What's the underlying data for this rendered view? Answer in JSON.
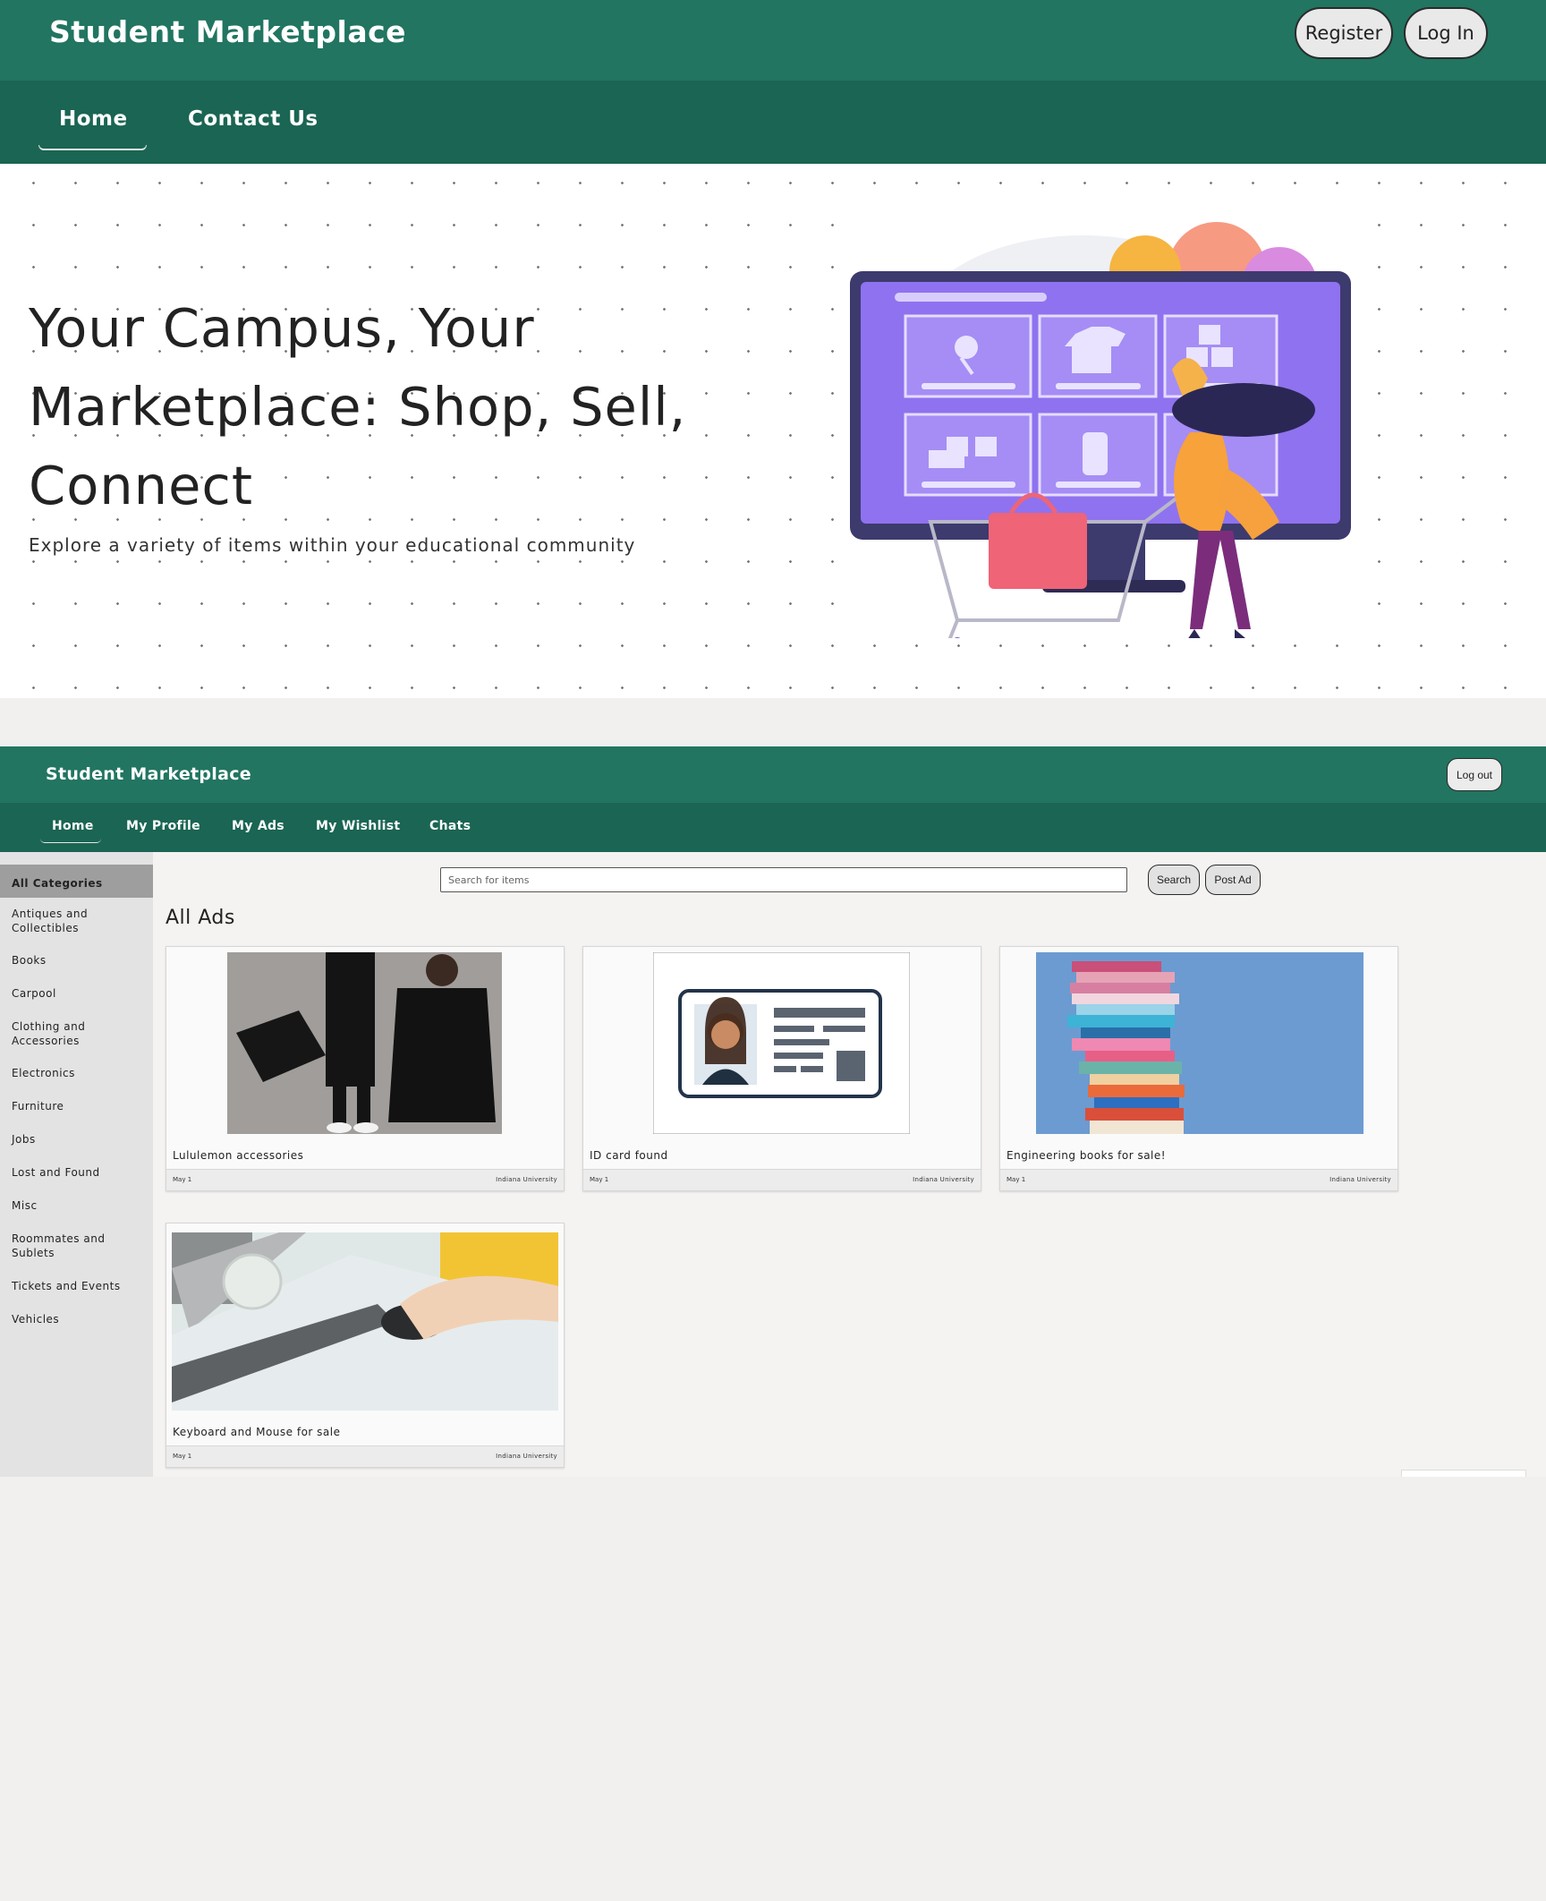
{
  "landing": {
    "brand": "Student Marketplace",
    "register_label": "Register",
    "login_label": "Log In",
    "nav": {
      "home": "Home",
      "contact": "Contact Us"
    },
    "hero": {
      "title": "Your Campus, Your Marketplace: Shop, Sell, Connect",
      "subtitle": "Explore a variety of items within your educational community"
    }
  },
  "dashboard": {
    "brand": "Student Marketplace",
    "logout_label": "Log out",
    "nav": {
      "items": [
        {
          "label": "Home"
        },
        {
          "label": "My Profile"
        },
        {
          "label": "My Ads"
        },
        {
          "label": "My Wishlist"
        },
        {
          "label": "Chats"
        }
      ]
    },
    "sidebar": {
      "items": [
        {
          "label": "All Categories"
        },
        {
          "label": "Antiques and Collectibles"
        },
        {
          "label": "Books"
        },
        {
          "label": "Carpool"
        },
        {
          "label": "Clothing and Accessories"
        },
        {
          "label": "Electronics"
        },
        {
          "label": "Furniture"
        },
        {
          "label": "Jobs"
        },
        {
          "label": "Lost and Found"
        },
        {
          "label": "Misc"
        },
        {
          "label": "Roommates and Sublets"
        },
        {
          "label": "Tickets and Events"
        },
        {
          "label": "Vehicles"
        }
      ]
    },
    "search": {
      "placeholder": "Search for items",
      "button_label": "Search"
    },
    "post_ad_label": "Post Ad",
    "section_title": "All Ads",
    "ads": [
      {
        "title": "Lululemon accessories",
        "date": "May 1",
        "university": "Indiana University"
      },
      {
        "title": "ID card found",
        "date": "May 1",
        "university": "Indiana University"
      },
      {
        "title": "Engineering books for sale!",
        "date": "May 1",
        "university": "Indiana University"
      },
      {
        "title": "Keyboard and Mouse for sale",
        "date": "May 1",
        "university": "Indiana University"
      }
    ]
  },
  "colors": {
    "header_green": "#217561",
    "nav_green": "#1a6553",
    "hero_purple": "#8a6ef0",
    "sidebar_active": "#9e9e9e"
  }
}
